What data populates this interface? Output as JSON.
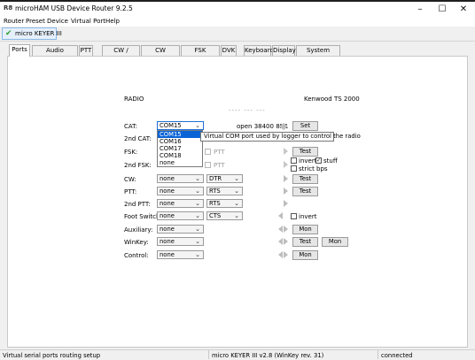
{
  "window": {
    "title": "microHAM USB Device Router 9.2.5",
    "minimize_glyph": "–",
    "maximize_glyph": "☐",
    "close_glyph": "✕",
    "app_icon": "router-icon",
    "app_icon_text": "R8"
  },
  "menu": [
    "Router",
    "Preset",
    "Device",
    "Virtual Port",
    "Help"
  ],
  "device_tab": {
    "label": "micro KEYER III",
    "check_glyph": "✔"
  },
  "tabs": [
    "Ports",
    "Audio Switching",
    "PTT",
    "CW / WinKey",
    "CW Messages",
    "FSK Messages",
    "DVK",
    "Keyboard",
    "Display",
    "System Settings"
  ],
  "active_tab": "Ports",
  "ports": {
    "radio_label": "RADIO",
    "radio_model": "Kenwood TS 2000",
    "dashes": "---- --- ---",
    "cat": {
      "label": "CAT:",
      "value": "COM15",
      "status": "open 38400 8N1",
      "set_label": "Set",
      "dropdown": [
        "COM15",
        "COM16",
        "COM17",
        "COM18",
        "none"
      ],
      "tooltip": "Virtual COM port used by logger to control the radio"
    },
    "cat2": {
      "label": "2nd CAT:"
    },
    "fsk": {
      "label": "FSK:",
      "ptt_label": "PTT",
      "test_label": "Test"
    },
    "fsk2": {
      "label": "2nd FSK:",
      "ptt_label": "PTT",
      "invert_label": "invert",
      "stuff_label": "stuff",
      "strict_label": "strict bps",
      "invert_checked": false,
      "stuff_checked": true,
      "strict_checked": false
    },
    "cw": {
      "label": "CW:",
      "value": "none",
      "line": "DTR",
      "test_label": "Test"
    },
    "ptt": {
      "label": "PTT:",
      "value": "none",
      "line": "RTS",
      "test_label": "Test"
    },
    "ptt2": {
      "label": "2nd PTT:",
      "value": "none",
      "line": "RTS"
    },
    "foot": {
      "label": "Foot Switch:",
      "value": "none",
      "line": "CTS",
      "invert_label": "invert"
    },
    "aux": {
      "label": "Auxiliary:",
      "value": "none",
      "mon_label": "Mon"
    },
    "winkey": {
      "label": "WinKey:",
      "value": "none",
      "test_label": "Test",
      "mon_label": "Mon"
    },
    "control": {
      "label": "Control:",
      "value": "none",
      "mon_label": "Mon"
    }
  },
  "status": {
    "left": "Virtual serial ports routing setup",
    "middle": "micro KEYER III v2.8 (WinKey rev. 31)",
    "right": "connected"
  },
  "glyphs": {
    "combo_arrow": "⌄"
  }
}
